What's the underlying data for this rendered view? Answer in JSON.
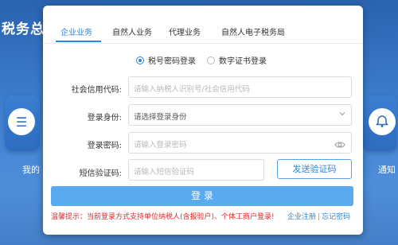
{
  "background": {
    "title_fragment": "税务总",
    "left_card_label": "我的",
    "right_card_label": "通知"
  },
  "tabs": [
    {
      "label": "企业业务",
      "active": true
    },
    {
      "label": "自然人业务",
      "active": false
    },
    {
      "label": "代理业务",
      "active": false
    },
    {
      "label": "自然人电子税务局",
      "active": false
    }
  ],
  "login_method": {
    "options": [
      {
        "label": "税号密码登录",
        "selected": true
      },
      {
        "label": "数字证书登录",
        "selected": false
      }
    ]
  },
  "form": {
    "credit_code": {
      "label": "社会信用代码:",
      "placeholder": "请输入纳税人识别号/社会信用代码"
    },
    "identity": {
      "label": "登录身份:",
      "value": "请选择登录身份"
    },
    "password": {
      "label": "登录密码:",
      "placeholder": "请输入登录密码"
    },
    "sms_code": {
      "label": "短信验证码:",
      "placeholder": "请输入短信验证码"
    }
  },
  "buttons": {
    "send_code": "发送验证码",
    "login": "登 录"
  },
  "footer": {
    "tip": "温馨提示：当前登录方式支持单位纳税人(含报验户)、个体工商户登录!",
    "register": "企业注册",
    "separator": "|",
    "forgot": "忘记密码"
  },
  "colors": {
    "accent": "#2b86e0",
    "login_button": "#5aaaf0",
    "warning": "#e02b2b"
  }
}
